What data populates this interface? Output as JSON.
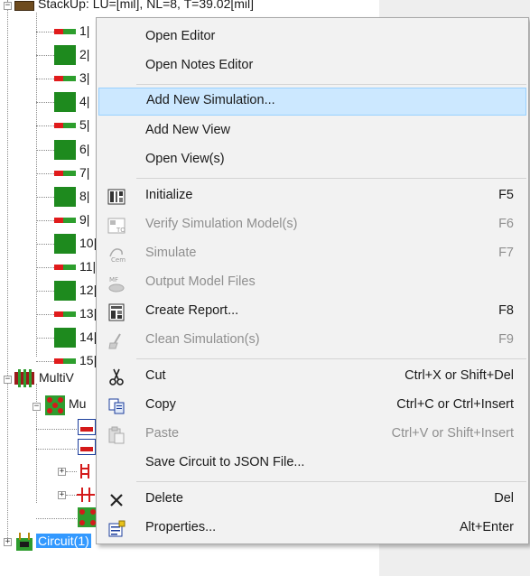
{
  "tree": {
    "stackup_label": "StackUp: LU=[mil], NL=8, T=39.02[mil]",
    "layers": [
      "1|",
      "2|",
      "3|",
      "4|",
      "5|",
      "6|",
      "7|",
      "8|",
      "9|",
      "10|",
      "11|",
      "12|",
      "13|",
      "14|",
      "15|"
    ],
    "multiview_label": "MultiV",
    "mu_label": "Mu",
    "circuit_label": "Circuit(1)"
  },
  "context_menu": {
    "items": [
      {
        "label": "Open Editor",
        "shortcut": "",
        "icon": "",
        "disabled": false
      },
      {
        "label": "Open Notes Editor",
        "shortcut": "",
        "icon": "",
        "disabled": false
      },
      {
        "label": "Add New Simulation...",
        "shortcut": "",
        "icon": "",
        "disabled": false,
        "highlighted": true
      },
      {
        "label": "Add New View",
        "shortcut": "",
        "icon": "",
        "disabled": false
      },
      {
        "label": "Open View(s)",
        "shortcut": "",
        "icon": "",
        "disabled": false
      },
      {
        "label": "Initialize",
        "shortcut": "F5",
        "icon": "initialize-icon",
        "disabled": false
      },
      {
        "label": "Verify Simulation Model(s)",
        "shortcut": "F6",
        "icon": "verify-icon",
        "disabled": true
      },
      {
        "label": "Simulate",
        "shortcut": "F7",
        "icon": "simulate-icon",
        "disabled": true
      },
      {
        "label": "Output Model Files",
        "shortcut": "",
        "icon": "output-model-icon",
        "disabled": true
      },
      {
        "label": "Create Report...",
        "shortcut": "F8",
        "icon": "report-icon",
        "disabled": false
      },
      {
        "label": "Clean Simulation(s)",
        "shortcut": "F9",
        "icon": "clean-icon",
        "disabled": true
      },
      {
        "label": "Cut",
        "shortcut": "Ctrl+X or Shift+Del",
        "icon": "scissors-icon",
        "disabled": false
      },
      {
        "label": "Copy",
        "shortcut": "Ctrl+C or Ctrl+Insert",
        "icon": "copy-icon",
        "disabled": false
      },
      {
        "label": "Paste",
        "shortcut": "Ctrl+V or Shift+Insert",
        "icon": "paste-icon",
        "disabled": true
      },
      {
        "label": "Save Circuit to JSON File...",
        "shortcut": "",
        "icon": "",
        "disabled": false
      },
      {
        "label": "Delete",
        "shortcut": "Del",
        "icon": "delete-x-icon",
        "disabled": false
      },
      {
        "label": "Properties...",
        "shortcut": "Alt+Enter",
        "icon": "properties-icon",
        "disabled": false
      }
    ]
  }
}
